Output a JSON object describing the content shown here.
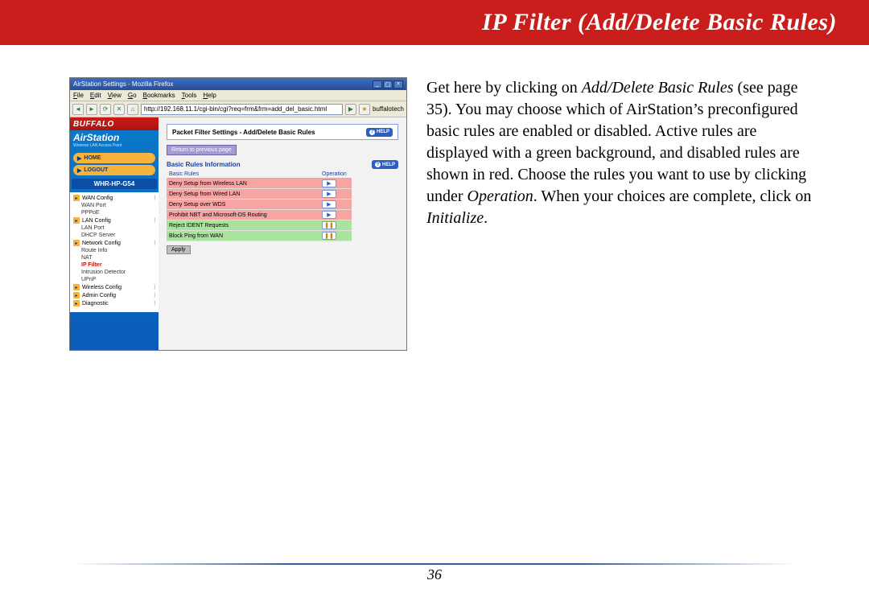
{
  "banner": {
    "title": "IP Filter (Add/Delete Basic Rules)"
  },
  "paragraph": {
    "t1": "Get here by clicking on ",
    "i1": "Add/Delete Basic Rules",
    "t2": " (see page 35).  You may choose which of AirStation’s preconfigured basic rules are enabled or disabled.  Active rules are displayed with a green background, and disabled rules are shown in red.  Choose the rules you want to use by clicking under ",
    "i2": "Operation",
    "t3": ".  When your choices are complete, click on ",
    "i3": "Initialize",
    "t4": "."
  },
  "window": {
    "title": "AirStation Settings - Mozilla Firefox",
    "url": "http://192.168.11.1/cgi-bin/cgi?req=frm&frm=add_del_basic.html",
    "bookmark": "buffalotech"
  },
  "menu": {
    "file": "File",
    "edit": "Edit",
    "view": "View",
    "go": "Go",
    "bookmarks": "Bookmarks",
    "tools": "Tools",
    "help": "Help"
  },
  "sidebar": {
    "brand": "BUFFALO",
    "product": "AirStation",
    "subtitle": "Wireless LAN Access Point",
    "home": "HOME",
    "logout": "LOGOUT",
    "model": "WHR-HP-G54",
    "items": [
      {
        "label": "WAN Config",
        "top": true
      },
      {
        "label": "WAN Port",
        "sub": true
      },
      {
        "label": "PPPoE",
        "sub": true
      },
      {
        "label": "LAN Config",
        "top": true
      },
      {
        "label": "LAN Port",
        "sub": true
      },
      {
        "label": "DHCP Server",
        "sub": true
      },
      {
        "label": "Network Config",
        "top": true
      },
      {
        "label": "Route Info",
        "sub": true
      },
      {
        "label": "NAT",
        "sub": true
      },
      {
        "label": "IP Filter",
        "sub": true,
        "active": true
      },
      {
        "label": "Intrusion Detector",
        "sub": true
      },
      {
        "label": "UPnP",
        "sub": true
      },
      {
        "label": "Wireless Config",
        "top": true
      },
      {
        "label": "Admin Config",
        "top": true
      },
      {
        "label": "Diagnostic",
        "top": true
      }
    ]
  },
  "main": {
    "header": "Packet Filter Settings - Add/Delete Basic Rules",
    "help": "HELP",
    "return": "Return to previous page",
    "section": "Basic Rules Information",
    "col_rule": "Basic Rules",
    "col_op": "Operation",
    "apply": "Apply"
  },
  "rules": [
    {
      "name": "Deny Setup from Wireless LAN",
      "state": "red",
      "op": "play"
    },
    {
      "name": "Deny Setup from Wired LAN",
      "state": "red",
      "op": "play"
    },
    {
      "name": "Deny Setup over WDS",
      "state": "red",
      "op": "play"
    },
    {
      "name": "Prohibit NBT and Microsoft-DS Routing",
      "state": "red",
      "op": "play"
    },
    {
      "name": "Reject IDENT Requests",
      "state": "green",
      "op": "pause"
    },
    {
      "name": "Block Ping from WAN",
      "state": "green",
      "op": "pause"
    }
  ],
  "footer": {
    "page": "36"
  }
}
